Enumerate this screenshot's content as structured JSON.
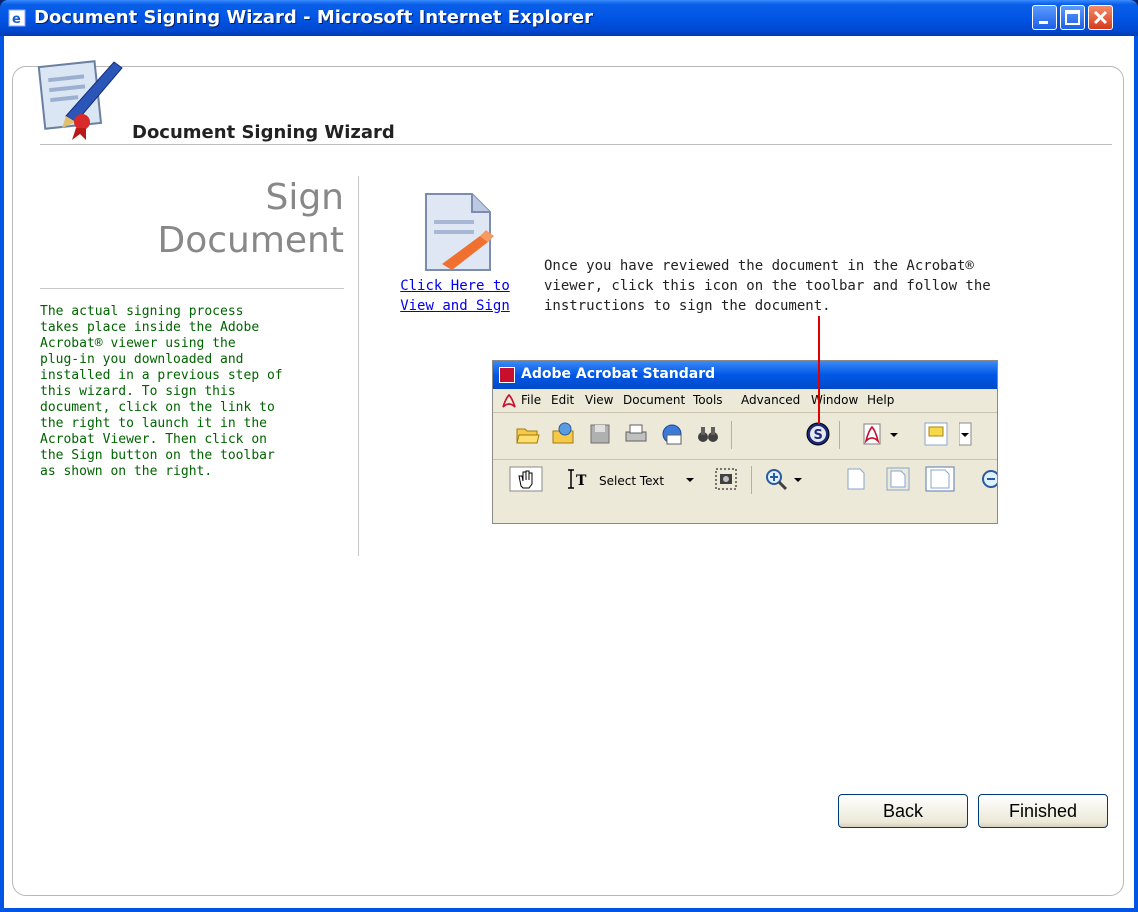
{
  "window": {
    "title": "Document Signing Wizard - Microsoft Internet Explorer"
  },
  "header": {
    "title": "Document Signing Wizard"
  },
  "sidebar": {
    "step_title_line1": "Sign",
    "step_title_line2": "Document",
    "instructions": "The actual signing process\ntakes place inside the Adobe\nAcrobat® viewer using the\nplug-in you downloaded and\ninstalled in a previous step of\nthis wizard. To sign this\ndocument, click on the link to\nthe right to launch it in the\nAcrobat Viewer. Then click on\nthe Sign button on the toolbar\nas shown on the right."
  },
  "main": {
    "view_link": "Click Here to\nView and Sign",
    "review_text": "Once you have reviewed the document in the Acrobat®\nviewer, click this icon on the toolbar and follow the\ninstructions to sign the document.",
    "acrobat": {
      "title": "Adobe Acrobat Standard",
      "menu": [
        "File",
        "Edit",
        "View",
        "Document",
        "Tools",
        "Advanced",
        "Window",
        "Help"
      ],
      "select_text": "Select Text"
    }
  },
  "footer": {
    "back_label": "Back",
    "finished_label": "Finished"
  },
  "colors": {
    "title_bar": "#0055e5",
    "instructions_text": "#006400",
    "link": "#0000ee",
    "pointer_line": "#e00000"
  }
}
